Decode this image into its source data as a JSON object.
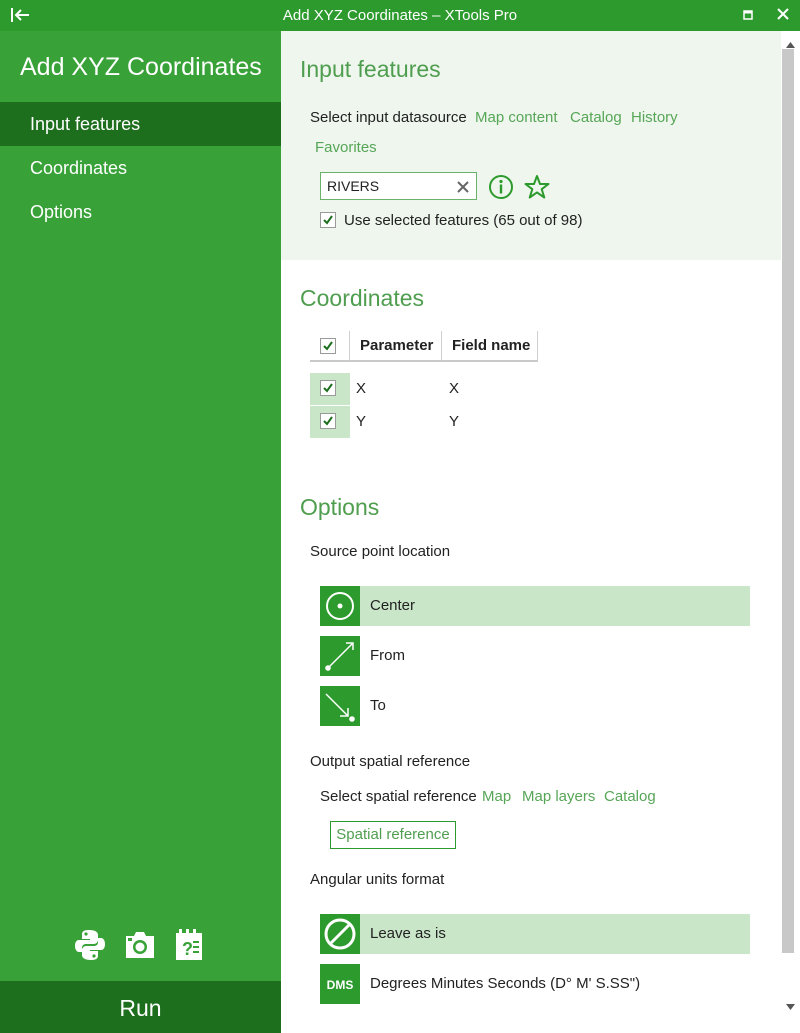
{
  "window": {
    "title": "Add XYZ Coordinates – XTools Pro"
  },
  "sidebar": {
    "app_title": "Add XYZ Coordinates",
    "nav": [
      {
        "label": "Input features",
        "active": true
      },
      {
        "label": "Coordinates",
        "active": false
      },
      {
        "label": "Options",
        "active": false
      }
    ],
    "tools": [
      "python-icon",
      "camera-icon",
      "help-icon"
    ],
    "run_label": "Run"
  },
  "input_features": {
    "title": "Input features",
    "datasource_label": "Select input datasource",
    "sources": [
      "Map content",
      "Catalog",
      "History",
      "Favorites"
    ],
    "datasource_value": "RIVERS",
    "use_selected_label": "Use selected features (65 out of 98)",
    "use_selected_checked": true
  },
  "coordinates": {
    "title": "Coordinates",
    "columns": [
      "Parameter",
      "Field name"
    ],
    "rows": [
      {
        "parameter": "X",
        "field": "X",
        "checked": true
      },
      {
        "parameter": "Y",
        "field": "Y",
        "checked": true
      }
    ]
  },
  "options": {
    "title": "Options",
    "source_point_label": "Source point location",
    "source_points": [
      {
        "label": "Center",
        "icon": "center-point-icon",
        "selected": true
      },
      {
        "label": "From",
        "icon": "from-point-icon",
        "selected": false
      },
      {
        "label": "To",
        "icon": "to-point-icon",
        "selected": false
      }
    ],
    "spatial_ref_label": "Output spatial reference",
    "select_spatial_label": "Select spatial reference",
    "spatial_links": [
      "Map",
      "Map layers",
      "Catalog"
    ],
    "spatial_button": "Spatial reference",
    "angular_label": "Angular units format",
    "angular_options": [
      {
        "label": "Leave as is",
        "icon": "no-change-icon",
        "selected": true
      },
      {
        "label": "Degrees Minutes Seconds (D° M' S.SS\")",
        "icon": "dms-icon",
        "icon_text": "DMS",
        "selected": false
      }
    ]
  },
  "colors": {
    "accent": "#2c9a2c",
    "sidebar": "#38a238",
    "sidebar_active": "#1d6f1d",
    "selected_row": "#c9e6c9",
    "panel_bg": "#eef6ee"
  }
}
